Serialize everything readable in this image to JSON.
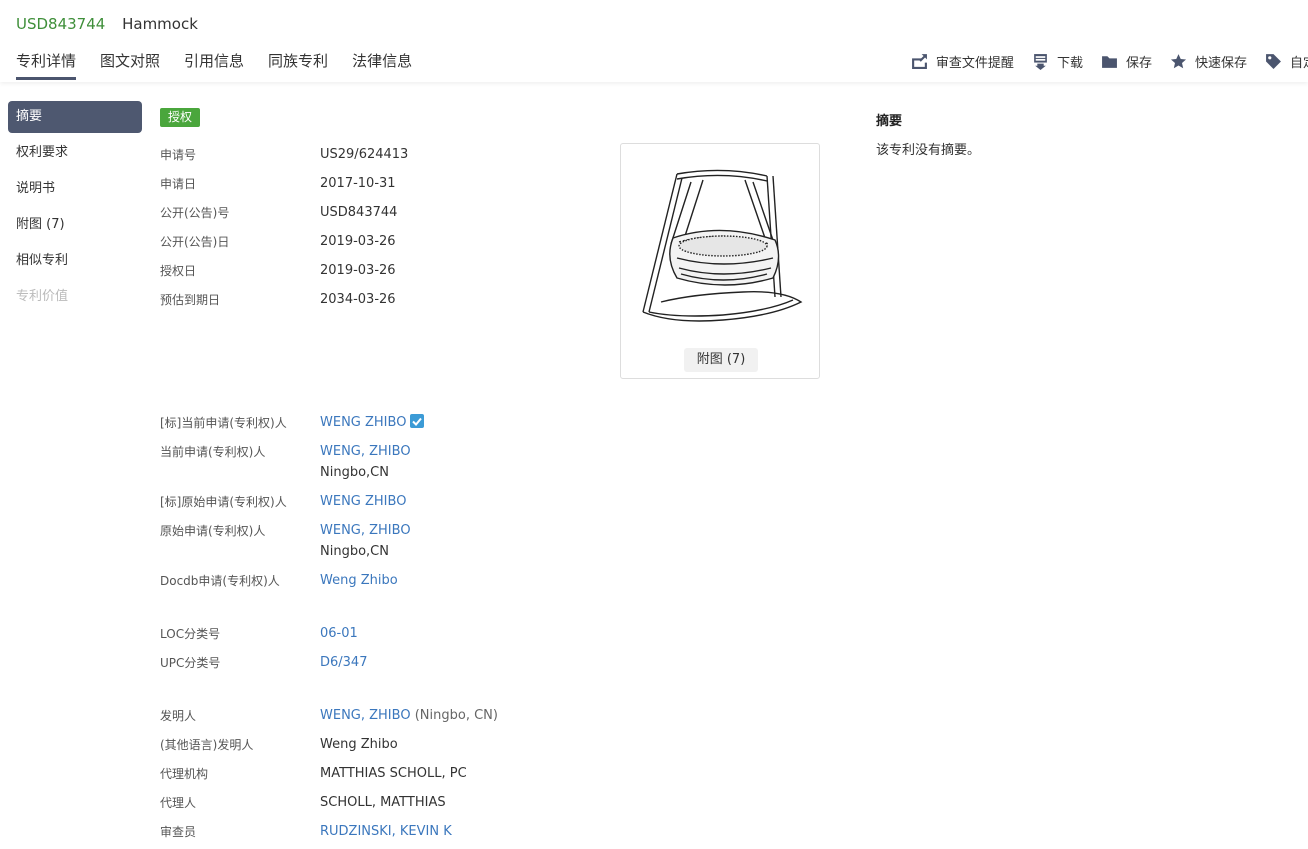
{
  "header": {
    "pub_no": "USD843744",
    "title": "Hammock",
    "tabs": [
      "专利详情",
      "图文对照",
      "引用信息",
      "同族专利",
      "法律信息"
    ],
    "actions": [
      {
        "label": "审查文件提醒",
        "icon": "review-alert-icon"
      },
      {
        "label": "下载",
        "icon": "pdf-download-icon"
      },
      {
        "label": "保存",
        "icon": "folder-icon"
      },
      {
        "label": "快速保存",
        "icon": "star-icon"
      },
      {
        "label": "自定",
        "icon": "tag-icon"
      }
    ]
  },
  "sidenav": {
    "items": [
      "摘要",
      "权利要求",
      "说明书",
      "附图 (7)",
      "相似专利",
      "专利价值"
    ]
  },
  "status_badge": "授权",
  "basic": [
    {
      "label": "申请号",
      "value": "US29/624413"
    },
    {
      "label": "申请日",
      "value": "2017-10-31"
    },
    {
      "label": "公开(公告)号",
      "value": "USD843744"
    },
    {
      "label": "公开(公告)日",
      "value": "2019-03-26"
    },
    {
      "label": "授权日",
      "value": "2019-03-26"
    },
    {
      "label": "预估到期日",
      "value": "2034-03-26"
    }
  ],
  "applicants": [
    {
      "label": "[标]当前申请(专利权)人",
      "value": "WENG ZHIBO"
    },
    {
      "label": "当前申请(专利权)人",
      "value": "WENG, ZHIBO",
      "sub": "Ningbo,CN"
    },
    {
      "label": "[标]原始申请(专利权)人",
      "value": "WENG ZHIBO"
    },
    {
      "label": "原始申请(专利权)人",
      "value": "WENG, ZHIBO",
      "sub": "Ningbo,CN"
    },
    {
      "label": "Docdb申请(专利权)人",
      "value": "Weng Zhibo"
    }
  ],
  "classes": [
    {
      "label": "LOC分类号",
      "value": "06-01"
    },
    {
      "label": "UPC分类号",
      "value": "D6/347"
    }
  ],
  "people": [
    {
      "label": "发明人",
      "value": "WENG, ZHIBO",
      "suffix": "(Ningbo, CN)"
    },
    {
      "label": "(其他语言)发明人",
      "value": "Weng Zhibo"
    },
    {
      "label": "代理机构",
      "value": "MATTHIAS SCHOLL, PC"
    },
    {
      "label": "代理人",
      "value": "SCHOLL, MATTHIAS"
    },
    {
      "label": "审查员",
      "value": "RUDZINSKI, KEVIN K"
    }
  ],
  "figure": {
    "button": "附图 (7)"
  },
  "abstract": {
    "title": "摘要",
    "text": "该专利没有摘要。"
  },
  "colors": {
    "accent": "#4e5870",
    "link": "#3b77bd",
    "green": "#3f8f3a",
    "badge": "#4aa63c"
  }
}
